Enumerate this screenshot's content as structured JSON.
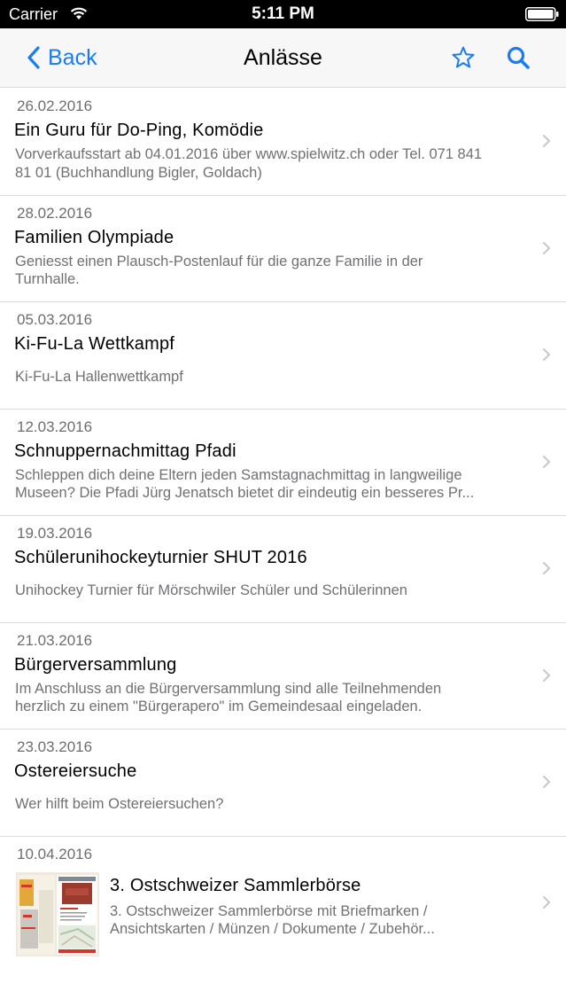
{
  "status_bar": {
    "carrier": "Carrier",
    "time": "5:11 PM"
  },
  "nav": {
    "back_label": "Back",
    "title": "Anlässe",
    "accent": "#1a7cf0"
  },
  "events": [
    {
      "date": "26.02.2016",
      "title": "Ein Guru für Do-Ping, Komödie",
      "desc_line1": "Vorverkaufsstart ab 04.01.2016 über www.spielwitz.ch oder Tel. 071 841",
      "desc_line2": "81 01 (Buchhandlung Bigler, Goldach)"
    },
    {
      "date": "28.02.2016",
      "title": "Familien Olympiade",
      "desc_line1": "Geniesst einen Plausch-Postenlauf für die ganze Familie in der",
      "desc_line2": "Turnhalle."
    },
    {
      "date": "05.03.2016",
      "title": "Ki-Fu-La Wettkampf",
      "desc_line1": "Ki-Fu-La Hallenwettkampf",
      "desc_line2": ""
    },
    {
      "date": "12.03.2016",
      "title": "Schnuppernachmittag Pfadi",
      "desc_line1": "Schleppen dich deine Eltern jeden Samstagnachmittag in langweilige",
      "desc_line2": "Museen? Die Pfadi Jürg Jenatsch bietet dir eindeutig ein besseres Pr..."
    },
    {
      "date": "19.03.2016",
      "title": "Schülerunihockeyturnier SHUT 2016",
      "desc_line1": "Unihockey Turnier für Mörschwiler Schüler und Schülerinnen",
      "desc_line2": ""
    },
    {
      "date": "21.03.2016",
      "title": "Bürgerversammlung",
      "desc_line1": "Im Anschluss an die Bürgerversammlung sind alle Teilnehmenden",
      "desc_line2": "herzlich zu einem \"Bürgerapero\" im Gemeindesaal eingeladen."
    },
    {
      "date": "23.03.2016",
      "title": "Ostereiersuche",
      "desc_line1": "Wer hilft beim Ostereiersuchen?",
      "desc_line2": ""
    },
    {
      "date": "10.04.2016",
      "title": "3. Ostschweizer Sammlerbörse",
      "desc_line1": "3. Ostschweizer Sammlerbörse mit Briefmarken /",
      "desc_line2": "Ansichtskarten / Münzen / Dokumente / Zubehör..."
    }
  ]
}
